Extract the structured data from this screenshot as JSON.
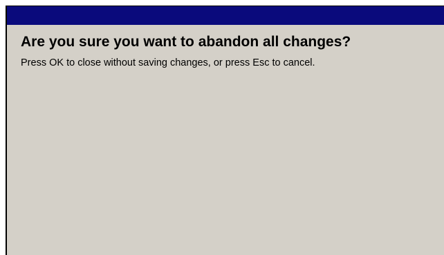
{
  "dialog": {
    "heading": "Are you sure you want to abandon all changes?",
    "message": "Press OK to close without saving changes, or press Esc to cancel."
  },
  "colors": {
    "title_bar": "#0a0a7c",
    "background": "#d4d0c8"
  }
}
